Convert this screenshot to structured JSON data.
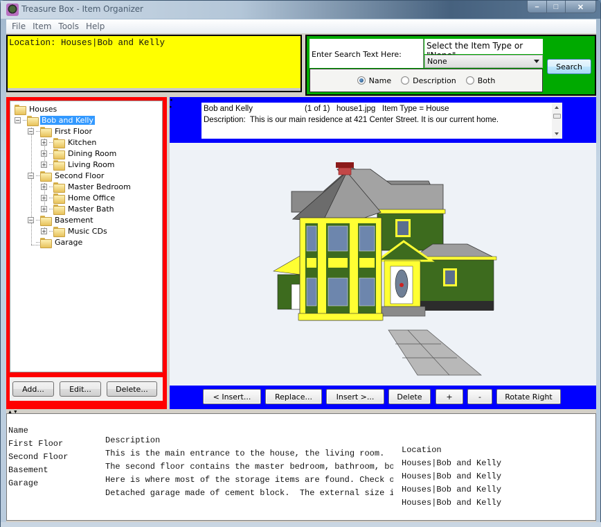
{
  "window": {
    "title": "Treasure Box - Item Organizer",
    "controls": {
      "minimize": "–",
      "maximize": "□",
      "close": "✕"
    }
  },
  "menu": [
    "File",
    "Item",
    "Tools",
    "Help"
  ],
  "location": {
    "text": "Location: Houses|Bob and Kelly",
    "bg_color": "#ffff00"
  },
  "search": {
    "bg_color": "#00aa00",
    "text_label": "Enter Search Text Here:",
    "type_label": "Select the Item Type or \"None\"",
    "type_selected": "None",
    "options": [
      {
        "label": "Name",
        "checked": true
      },
      {
        "label": "Description",
        "checked": false
      },
      {
        "label": "Both",
        "checked": false
      }
    ],
    "button": "Search"
  },
  "tree": {
    "bg_color": "#ff0000",
    "nodes": [
      {
        "label": "Houses",
        "level": 0,
        "expander": "none",
        "selected": false
      },
      {
        "label": "Bob and Kelly",
        "level": 1,
        "expander": "minus",
        "selected": true
      },
      {
        "label": "First Floor",
        "level": 2,
        "expander": "minus",
        "selected": false
      },
      {
        "label": "Kitchen",
        "level": 3,
        "expander": "plus",
        "selected": false
      },
      {
        "label": "Dining Room",
        "level": 3,
        "expander": "plus",
        "selected": false
      },
      {
        "label": "Living Room",
        "level": 3,
        "expander": "plus",
        "selected": false
      },
      {
        "label": "Second Floor",
        "level": 2,
        "expander": "minus",
        "selected": false
      },
      {
        "label": "Master Bedroom",
        "level": 3,
        "expander": "plus",
        "selected": false
      },
      {
        "label": "Home Office",
        "level": 3,
        "expander": "plus",
        "selected": false
      },
      {
        "label": "Master Bath",
        "level": 3,
        "expander": "plus",
        "selected": false
      },
      {
        "label": "Basement",
        "level": 2,
        "expander": "minus",
        "selected": false
      },
      {
        "label": "Music CDs",
        "level": 3,
        "expander": "plus",
        "selected": false
      },
      {
        "label": "Garage",
        "level": 2,
        "expander": "none",
        "selected": false
      }
    ],
    "buttons": {
      "add": "Add...",
      "edit": "Edit...",
      "delete": "Delete..."
    }
  },
  "detail": {
    "bg_color": "#0000ff",
    "name": "Bob and Kelly",
    "counter": "(1 of 1)",
    "filename": "house1.jpg",
    "item_type": "Item Type = House",
    "description": "Description:  This is our main residence at 421 Center Street. It is our current home."
  },
  "image_toolbar": {
    "insert_before": "< Insert...",
    "replace": "Replace...",
    "insert_after": "Insert >...",
    "delete": "Delete",
    "zoom_in": "+",
    "zoom_out": "-",
    "rotate": "Rotate Right"
  },
  "results": {
    "columns": [
      "Name",
      "Description",
      "Location"
    ],
    "rows": [
      [
        "First Floor",
        "This is the main entrance to the house, the living room.  I",
        "Houses|Bob and Kelly"
      ],
      [
        "Second Floor",
        "The second floor contains the master bedroom, bathroom, bow",
        "Houses|Bob and Kelly"
      ],
      [
        "Basement",
        "Here is where most of the storage items are found. Check ou",
        "Houses|Bob and Kelly"
      ],
      [
        "Garage",
        "Detached garage made of cement block.  The external size is",
        "Houses|Bob and Kelly"
      ]
    ]
  }
}
